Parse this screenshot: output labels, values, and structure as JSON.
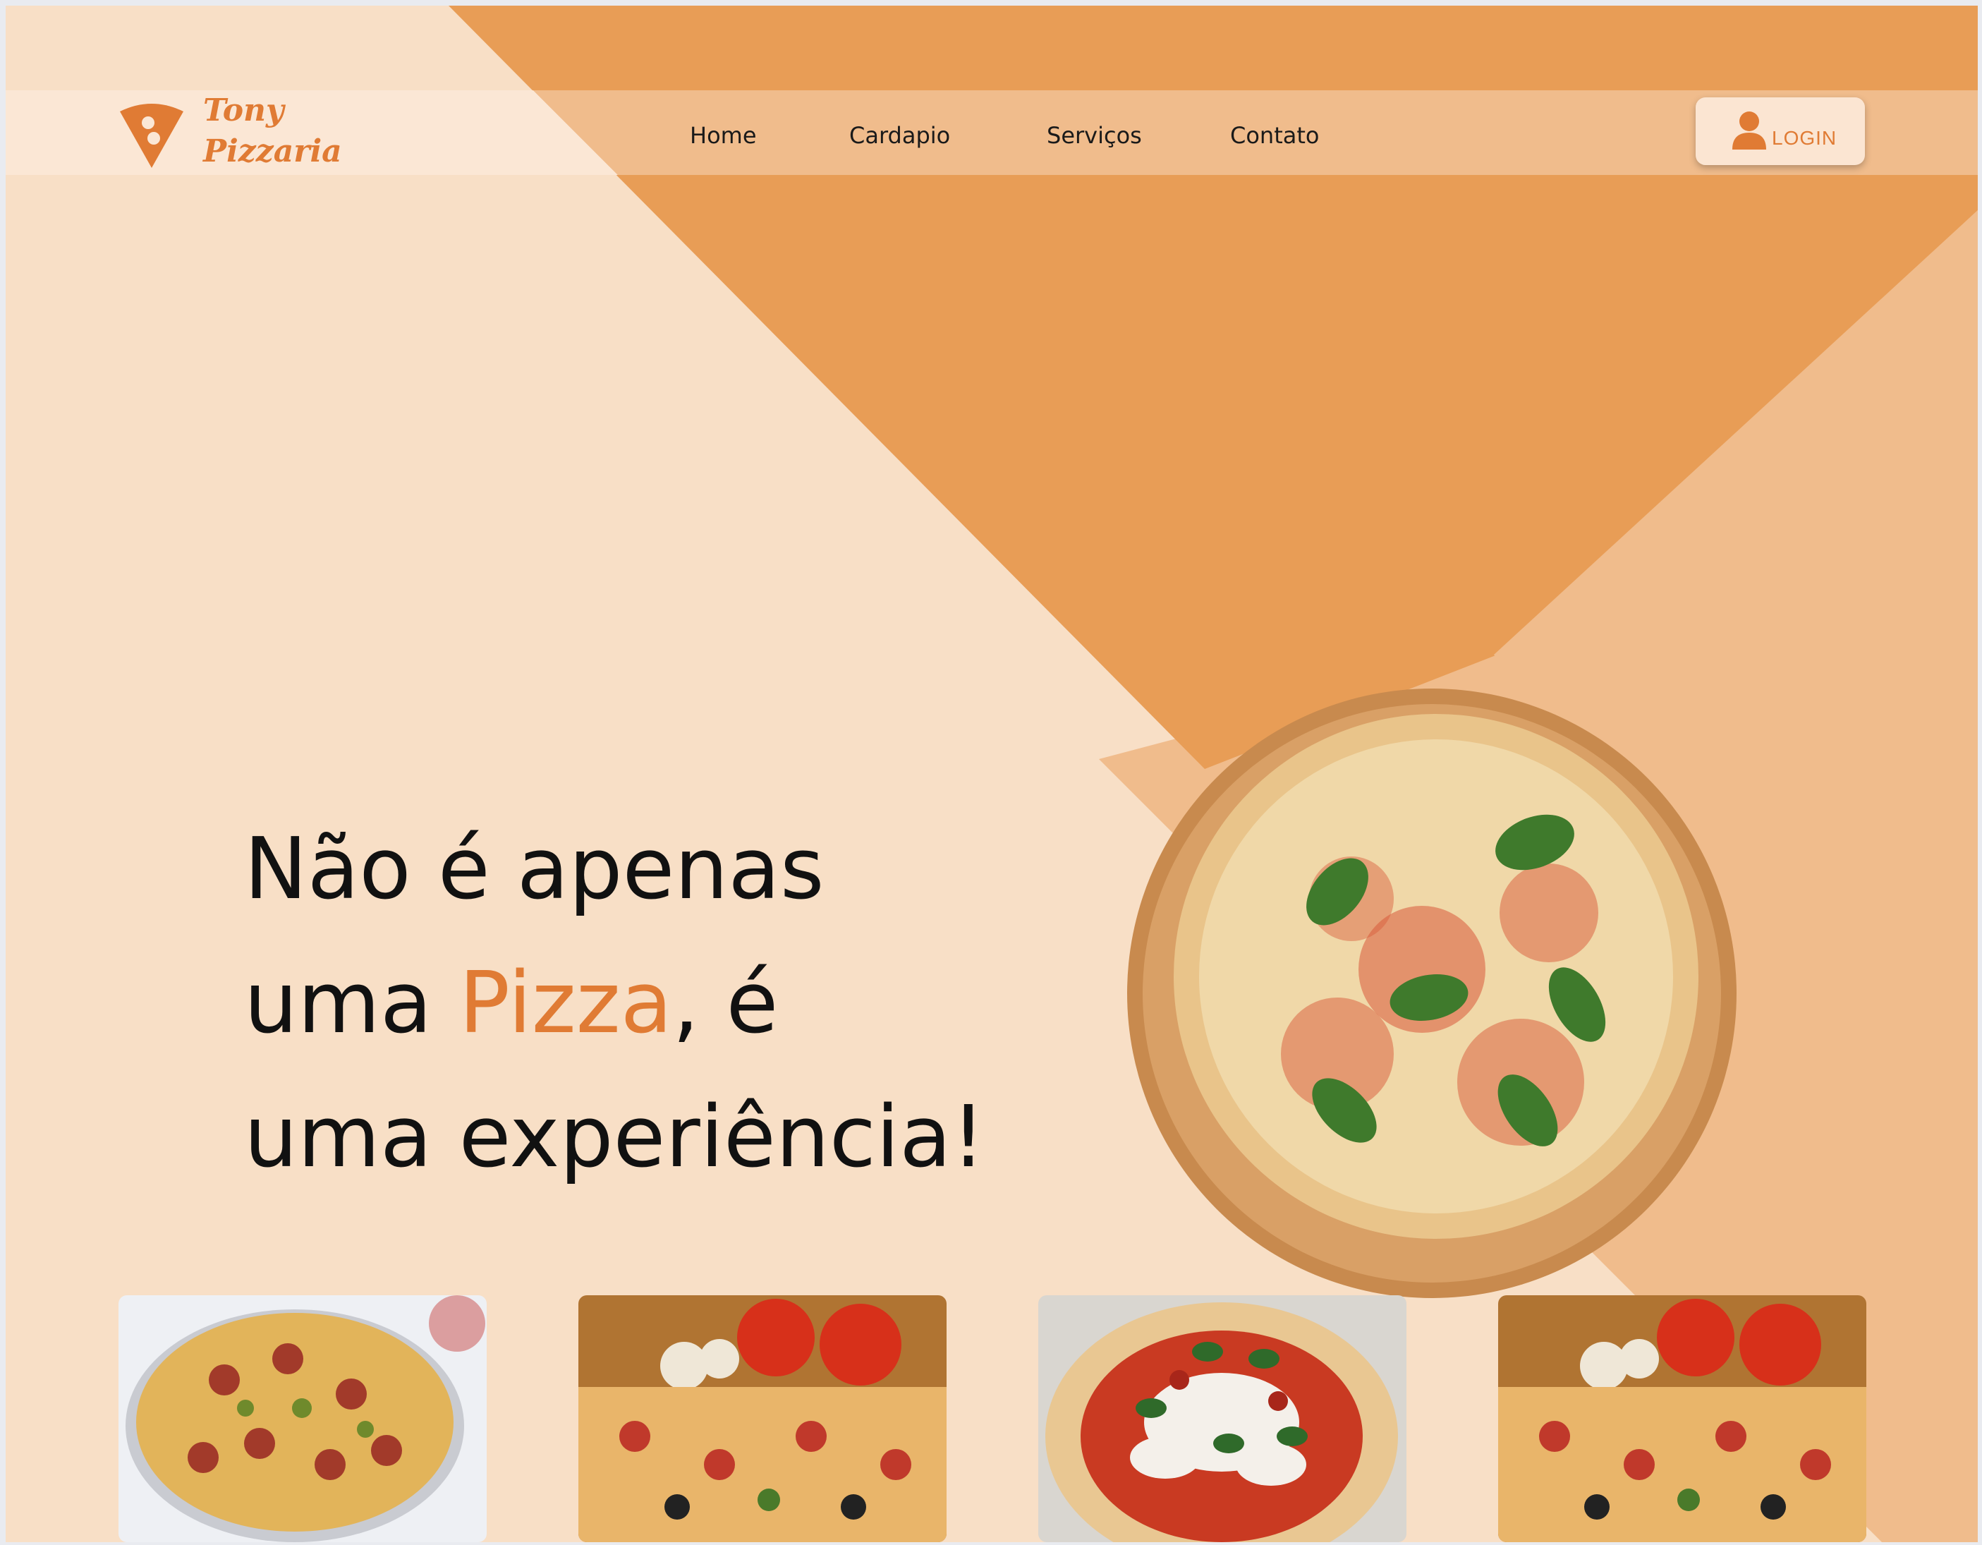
{
  "brand": {
    "name_line1": "Tony",
    "name_line2": "Pizzaria",
    "logo_icon": "pizza-slice-icon"
  },
  "nav": {
    "items": [
      {
        "label": "Home"
      },
      {
        "label": "Cardapio"
      },
      {
        "label": "Serviços"
      },
      {
        "label": "Contato"
      }
    ]
  },
  "login": {
    "label": "LOGIN",
    "icon": "user-icon"
  },
  "hero": {
    "line1": "Não é apenas",
    "line2_prefix": "uma ",
    "line2_accent": "Pizza",
    "line2_suffix": ", é",
    "line3": "uma experiência!"
  },
  "colors": {
    "background": "#f8dfc6",
    "accent": "#e07b34",
    "orange_band": "#e89d56",
    "light_orange": "#f0bc8c",
    "nav_light": "#fbe7d5"
  },
  "gallery": {
    "items": [
      {
        "alt": "pepperoni-olive-pizza"
      },
      {
        "alt": "pizza-with-tomatoes"
      },
      {
        "alt": "margherita-pizza"
      },
      {
        "alt": "pizza-with-tomatoes"
      }
    ]
  }
}
